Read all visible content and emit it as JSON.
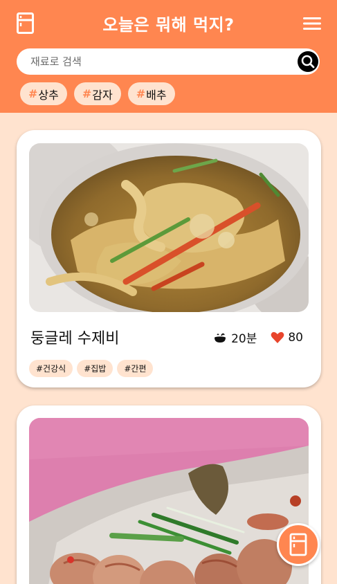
{
  "header": {
    "title": "오늘은 뭐해 먹지?",
    "fridge_icon": "fridge-icon",
    "menu_icon": "hamburger-menu-icon"
  },
  "search": {
    "placeholder": "재료로 검색",
    "value": "",
    "icon": "search-icon"
  },
  "ingredient_chips": [
    {
      "hash": "#",
      "label": "상추"
    },
    {
      "hash": "#",
      "label": "감자"
    },
    {
      "hash": "#",
      "label": "배추"
    }
  ],
  "recipes": [
    {
      "title": "둥글레 수제비",
      "time": "20분",
      "likes": "80",
      "tags": [
        "#건강식",
        "#집밥",
        "#간편"
      ]
    },
    {
      "title": "",
      "time": "",
      "likes": "",
      "tags": []
    }
  ],
  "colors": {
    "accent": "#ff8650",
    "background": "#ffe3cf",
    "heart": "#e8452c"
  },
  "fab": {
    "icon": "fridge-icon"
  }
}
